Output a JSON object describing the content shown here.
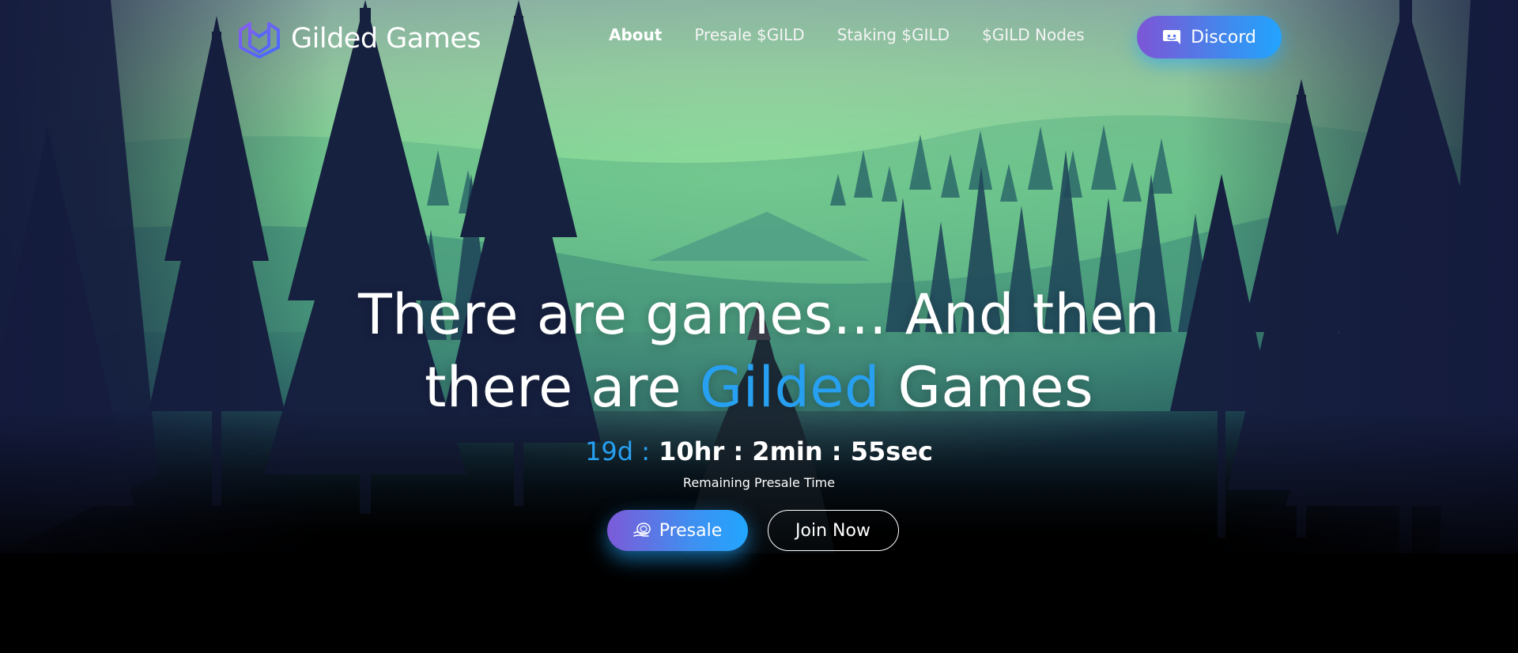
{
  "colors": {
    "accent": "#27a0f2",
    "gradient_start": "#7d55d6",
    "gradient_end": "#22a4ff",
    "text": "#ffffff",
    "background_bottom": "#000000"
  },
  "header": {
    "brand_name": "Gilded Games",
    "logo_icon": "gilded-games-logo-icon",
    "nav": [
      {
        "label": "About",
        "active": true
      },
      {
        "label": "Presale $GILD",
        "active": false
      },
      {
        "label": "Staking $GILD",
        "active": false
      },
      {
        "label": "$GILD Nodes",
        "active": false
      }
    ],
    "discord": {
      "label": "Discord",
      "icon": "discord-icon"
    }
  },
  "hero": {
    "title_line1": "There are games... And then",
    "title_line2_prefix": "there are ",
    "title_line2_accent": "Gilded",
    "title_line2_suffix": " Games",
    "countdown": {
      "days": "19d :",
      "rest": " 10hr : 2min : 55sec"
    },
    "countdown_caption": "Remaining Presale Time",
    "presale_button": {
      "label": "Presale",
      "icon": "coins-icon"
    },
    "join_button": {
      "label": "Join Now"
    }
  }
}
